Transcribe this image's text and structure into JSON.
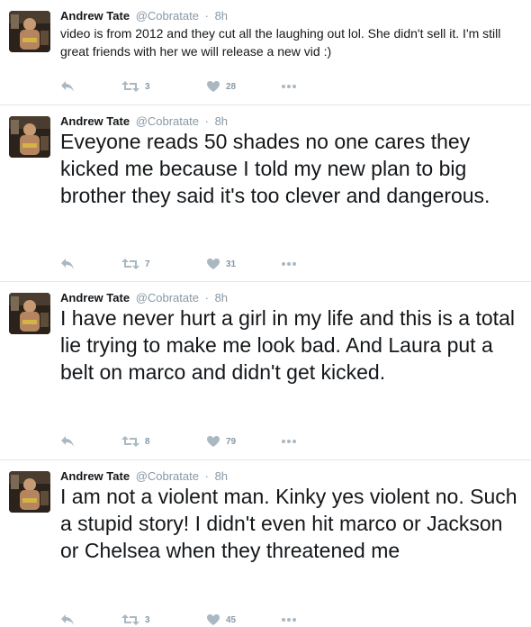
{
  "tweets": [
    {
      "name": "Andrew Tate",
      "handle": "@Cobratate",
      "separator": "·",
      "time": "8h",
      "text": "video is from 2012 and they cut all the laughing out lol. She didn't sell it. I'm still great friends with her we will release a new vid :)",
      "retweets": "3",
      "likes": "28"
    },
    {
      "name": "Andrew Tate",
      "handle": "@Cobratate",
      "separator": "·",
      "time": "8h",
      "text": "Eveyone reads 50 shades no one cares they kicked me because I told my new plan to big brother they said it's too clever and dangerous.",
      "retweets": "7",
      "likes": "31"
    },
    {
      "name": "Andrew Tate",
      "handle": "@Cobratate",
      "separator": "·",
      "time": "8h",
      "text": "I have never hurt a girl in my life and this is a total lie trying to make me look bad. And Laura put a belt on marco and didn't get kicked.",
      "retweets": "8",
      "likes": "79"
    },
    {
      "name": "Andrew Tate",
      "handle": "@Cobratate",
      "separator": "·",
      "time": "8h",
      "text": "I am not a violent man. Kinky yes violent no. Such a stupid story! I didn't even hit marco or Jackson or Chelsea when they threatened me",
      "retweets": "3",
      "likes": "45"
    }
  ],
  "icons": {
    "reply": "reply-icon",
    "retweet": "retweet-icon",
    "like": "heart-icon",
    "more": "more-dots-icon"
  },
  "colors": {
    "text": "#14171a",
    "secondary": "#8899a6",
    "icon": "#aab8c2",
    "divider": "#e1e8ed"
  }
}
